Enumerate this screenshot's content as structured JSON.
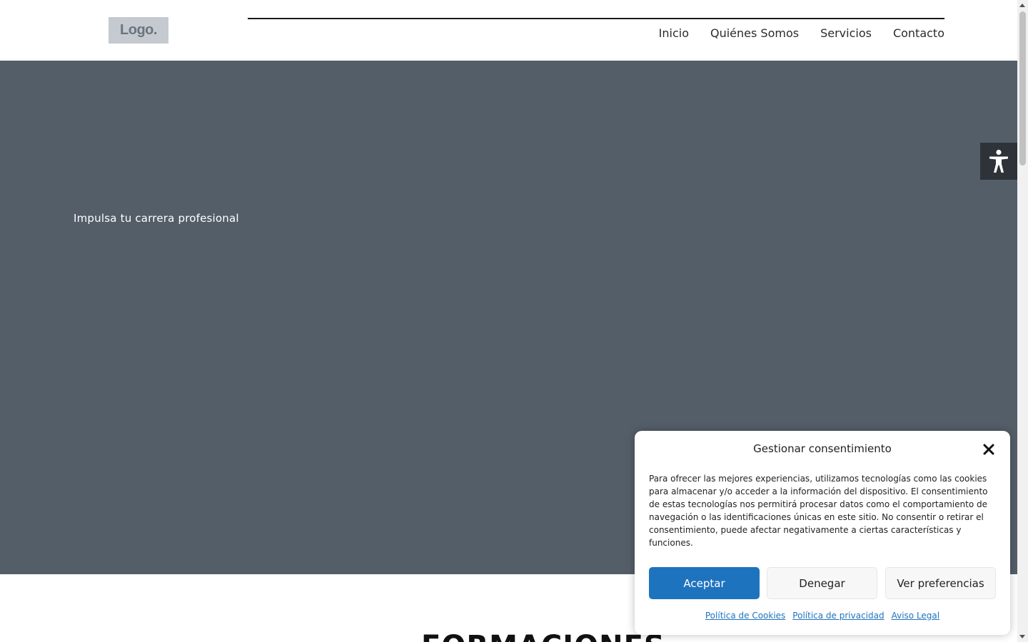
{
  "header": {
    "logo_text": "Logo.",
    "nav": [
      "Inicio",
      "Quiénes Somos",
      "Servicios",
      "Contacto"
    ]
  },
  "hero": {
    "tagline": "Impulsa tu carrera profesional",
    "bg_color": "#545e69"
  },
  "section": {
    "heading": "FORMACIONES"
  },
  "accessibility": {
    "icon": "accessibility-person-icon"
  },
  "consent": {
    "title": "Gestionar consentimiento",
    "body": "Para ofrecer las mejores experiencias, utilizamos tecnologías como las cookies para almacenar y/o acceder a la información del dispositivo. El consentimiento de estas tecnologías nos permitirá procesar datos como el comportamiento de navegación o las identificaciones únicas en este sitio. No consentir o retirar el consentimiento, puede afectar negativamente a ciertas características y funciones.",
    "accept_label": "Aceptar",
    "deny_label": "Denegar",
    "prefs_label": "Ver preferencias",
    "links": [
      "Política de Cookies",
      "Política de privacidad",
      "Aviso Legal"
    ],
    "accent_color": "#1e73be"
  }
}
